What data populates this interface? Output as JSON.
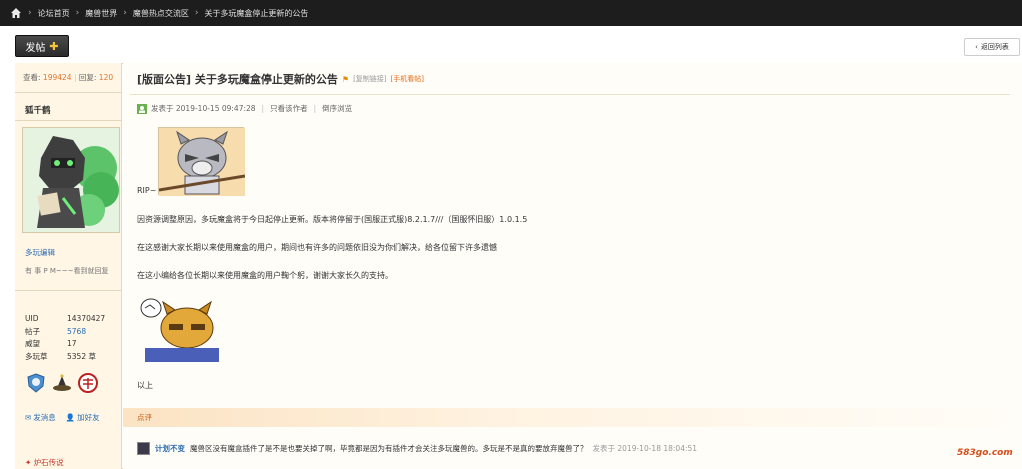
{
  "breadcrumb": {
    "items": [
      "论坛首页",
      "魔兽世界",
      "魔兽热点交流区",
      "关于多玩魔盒停止更新的公告"
    ]
  },
  "toolbar": {
    "post_label": "发帖",
    "back_label": "返回列表"
  },
  "thread": {
    "views_label": "查看:",
    "views": "199424",
    "replies_label": "回复:",
    "replies": "120",
    "title": "[版面公告] 关于多玩魔盒停止更新的公告",
    "copy_link": "[复制链接]",
    "mobile_view": "[手机看帖]"
  },
  "author": {
    "name": "狐千鹤",
    "group": "多玩编辑",
    "signature": "有 事 P M~~~看到就回复",
    "profile": [
      {
        "key": "UID",
        "value": "14370427",
        "link": false
      },
      {
        "key": "帖子",
        "value": "5768",
        "link": true
      },
      {
        "key": "威望",
        "value": "17",
        "link": false
      },
      {
        "key": "多玩草",
        "value": "5352 草",
        "link": false
      }
    ],
    "actions": {
      "message": "发消息",
      "add_friend": "加好友"
    },
    "medal_tag": "炉石传说"
  },
  "post": {
    "posted_at": "发表于 2019-10-15 09:47:28",
    "only_author": "只看该作者",
    "reverse": "倒序浏览",
    "rip": "RIP~",
    "paragraphs": [
      "因资源调整原因，多玩魔盒将于今日起停止更新。版本将停留于(国服正式服)8.2.1.7///（国服怀旧服）1.0.1.5",
      "在这感谢大家长期以来使用魔盒的用户，期间也有许多的问题依旧没为你们解决，给各位留下许多遗憾",
      "在这小编给各位长期以来使用魔盒的用户鞠个躬，谢谢大家长久的支持。"
    ],
    "ending": "以上"
  },
  "comments": {
    "label": "点评",
    "items": [
      {
        "user": "计划不变",
        "text": "魔兽区没有魔盒插件了是不是也要关掉了啊，毕竟都是因为有插件才会关注多玩魔兽的。多玩是不是真的要放弃魔兽了？",
        "time": "发表于 2019-10-18 18:04:51"
      }
    ]
  },
  "watermark": "583go.com"
}
